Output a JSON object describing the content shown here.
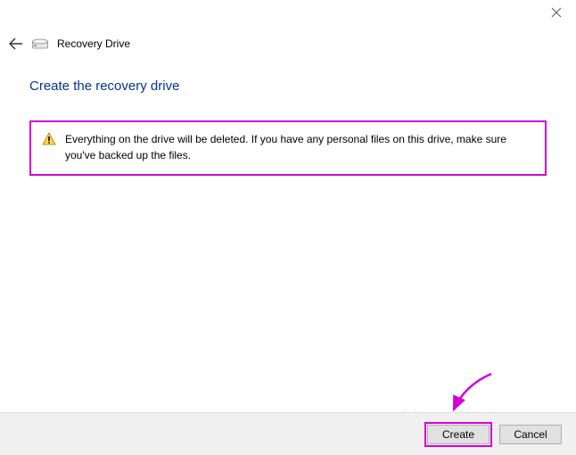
{
  "window": {
    "title": "Recovery Drive"
  },
  "page": {
    "heading": "Create the recovery drive"
  },
  "warning": {
    "message": "Everything on the drive will be deleted. If you have any personal files on this drive, make sure you've backed up the files."
  },
  "buttons": {
    "create": "Create",
    "cancel": "Cancel"
  },
  "annotation": {
    "highlight_color": "#d400d4"
  }
}
